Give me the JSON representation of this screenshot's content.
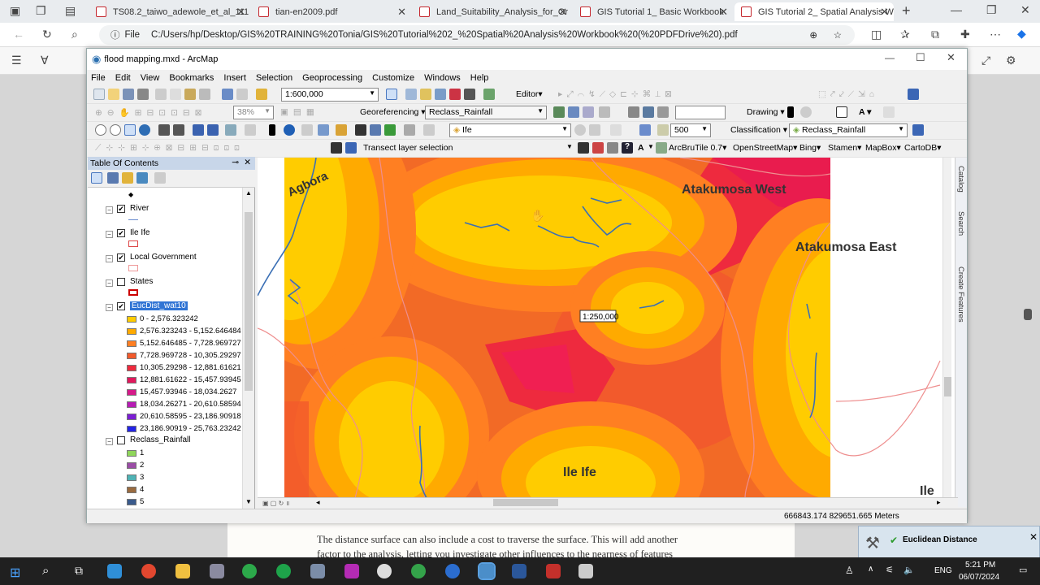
{
  "browser": {
    "tabs": [
      {
        "label": "TS08.2_taiwo_adewole_et_al_111"
      },
      {
        "label": "tian-en2009.pdf"
      },
      {
        "label": "Land_Suitability_Analysis_for_Or"
      },
      {
        "label": "GIS Tutorial 1_ Basic Workbook"
      },
      {
        "label": "GIS Tutorial 2_ Spatial Analysis W"
      }
    ],
    "url_prefix": "File",
    "url": "C:/Users/hp/Desktop/GIS%20TRAINING%20Tonia/GIS%20Tutorial%202_%20Spatial%20Analysis%20Workbook%20(%20PDFDrive%20).pdf"
  },
  "document": {
    "line1": "The distance surface can also include a cost to traverse the surface. This will add another",
    "line2": "factor to the analysis, letting you investigate other influences to the nearness of features"
  },
  "arcmap": {
    "title": "flood mapping.mxd - ArcMap",
    "menu": [
      "File",
      "Edit",
      "View",
      "Bookmarks",
      "Insert",
      "Selection",
      "Geoprocessing",
      "Customize",
      "Windows",
      "Help"
    ],
    "scale_combo": "1:600,000",
    "editor_label": "Editor▾",
    "zoom_percent": "38%",
    "georeferencing_label": "Georeferencing ▾",
    "georef_layer": "Reclass_Rainfall",
    "drawing_label": "Drawing ▾",
    "layer_combo": "Ife",
    "number_field": "500",
    "classification_label": "Classification ▾",
    "classification_layer": "Reclass_Rainfall",
    "transect_label": "Transect layer selection",
    "basemaps": [
      "ArcBruTile 0.7▾",
      "OpenStreetMap▾",
      "Bing▾",
      "Stamen▾",
      "MapBox▾",
      "CartoDB▾"
    ],
    "status_coords": "666843.174  829651.665 Meters"
  },
  "toc": {
    "title": "Table Of Contents",
    "layers": [
      {
        "name": "River",
        "checked": "✔"
      },
      {
        "name": "Ile Ife",
        "checked": "✔"
      },
      {
        "name": "Local Government",
        "checked": "✔"
      },
      {
        "name": "States",
        "checked": ""
      },
      {
        "name": "EucDist_wat10",
        "checked": "✔"
      },
      {
        "name": "Reclass_Rainfall",
        "checked": ""
      }
    ],
    "eucdist_classes": [
      {
        "label": "0 - 2,576.323242",
        "color": "#ffcc00"
      },
      {
        "label": "2,576.323243 - 5,152.646484",
        "color": "#ffaa00"
      },
      {
        "label": "5,152.646485 - 7,728.969727",
        "color": "#ff7f22"
      },
      {
        "label": "7,728.969728 - 10,305.29297",
        "color": "#f25a2c"
      },
      {
        "label": "10,305.29298 - 12,881.61621",
        "color": "#ee2a3e"
      },
      {
        "label": "12,881.61622 - 15,457.93945",
        "color": "#e1185c"
      },
      {
        "label": "15,457.93946 - 18,034.2627",
        "color": "#d61a8a"
      },
      {
        "label": "18,034.26271 - 20,610.58594",
        "color": "#b71cb4"
      },
      {
        "label": "20,610.58595 - 23,186.90918",
        "color": "#7c1ed4"
      },
      {
        "label": "23,186.90919 - 25,763.23242",
        "color": "#2424e6"
      }
    ],
    "reclass_classes": [
      {
        "label": "1",
        "color": "#8fd65a"
      },
      {
        "label": "2",
        "color": "#9b4da6"
      },
      {
        "label": "3",
        "color": "#4fb3b5"
      },
      {
        "label": "4",
        "color": "#9a6b3f"
      },
      {
        "label": "5",
        "color": "#3a5a8c"
      }
    ]
  },
  "map": {
    "labels": [
      "Agbora",
      "Atakumosa West",
      "Atakumosa East",
      "Ile Ife",
      "Ile"
    ],
    "scale_tip": "1:250,000"
  },
  "right_dock": [
    "Catalog",
    "Search",
    "Create Features"
  ],
  "toast": {
    "text": "Euclidean Distance"
  },
  "taskbar": {
    "lang": "ENG",
    "time": "5:21 PM",
    "date": "06/07/2024"
  }
}
